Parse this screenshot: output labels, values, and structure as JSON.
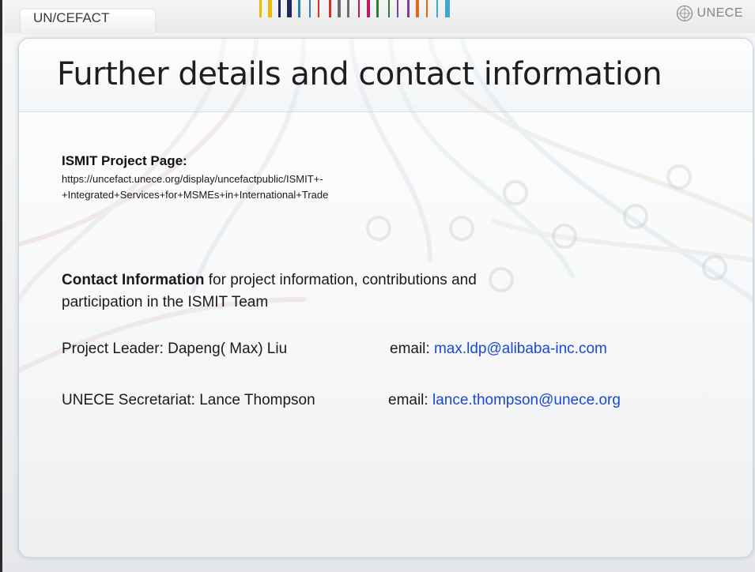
{
  "header": {
    "org": "UN/CEFACT",
    "logo_text": "UNECE",
    "logo_icon": "un-emblem-icon"
  },
  "barcode_colors": [
    "#f2b800",
    "#1f2a5c",
    "#2a7fc1",
    "#d32f2f",
    "#6c6c6c",
    "#c2185b",
    "#2e7d32",
    "#7a3fa0",
    "#e06a1b",
    "#3ea6d8"
  ],
  "slide": {
    "title": "Further details and contact information",
    "project_page": {
      "label": "ISMIT Project Page:",
      "url_line1": "https://uncefact.unece.org/display/uncefactpublic/ISMIT+-",
      "url_line2": "+Integrated+Services+for+MSMEs+in+International+Trade"
    },
    "contact": {
      "label": "Contact Information",
      "text_line1": " for project information, contributions and",
      "text_line2": "participation in the ISMIT Team"
    },
    "contacts": [
      {
        "role": "Project Leader: Dapeng( Max) Liu",
        "email_label": "email: ",
        "email": "max.ldp@alibaba-inc.com"
      },
      {
        "role": "UNECE Secretariat: Lance Thompson",
        "email_label": "email: ",
        "email": "lance.thompson@unece.org"
      }
    ]
  },
  "colors": {
    "link": "#1a47d6",
    "panel_border": "#c9d3dc"
  }
}
